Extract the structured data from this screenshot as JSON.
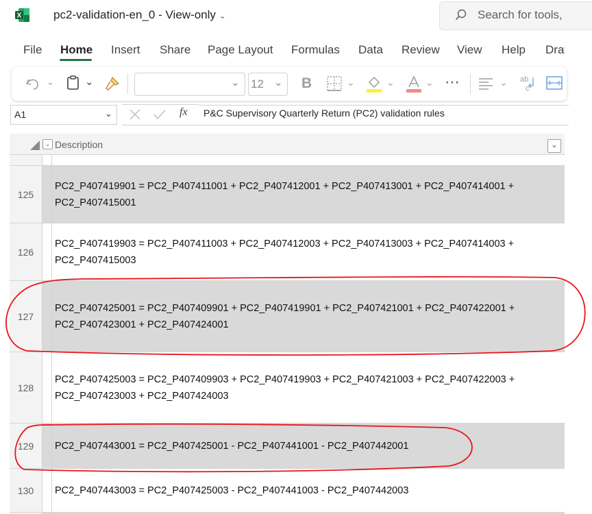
{
  "app": {
    "file_name": "pc2-validation-en_0",
    "mode": "View-only",
    "search_placeholder": "Search for tools,"
  },
  "menu": [
    "File",
    "Home",
    "Insert",
    "Share",
    "Page Layout",
    "Formulas",
    "Data",
    "Review",
    "View",
    "Help",
    "Draw"
  ],
  "toolbar": {
    "font_size": "12",
    "undo_icon": "undo-icon",
    "paste_icon": "clipboard-icon",
    "format_painter_icon": "brush-icon",
    "bold_label": "B"
  },
  "formula_bar": {
    "name_box": "A1",
    "fx": "fx",
    "content": "P&C Supervisory Quarterly Return (PC2) validation rules"
  },
  "grid": {
    "column_header": "Description",
    "rows": [
      {
        "num": "125",
        "shaded": true,
        "lines": [
          "PC2_P407419901 = PC2_P407411001 + PC2_P407412001 + PC2_P407413001 + PC2_P407414001 +",
          "PC2_P407415001"
        ]
      },
      {
        "num": "126",
        "shaded": false,
        "lines": [
          "PC2_P407419903 = PC2_P407411003 + PC2_P407412003 + PC2_P407413003 + PC2_P407414003 +",
          "PC2_P407415003"
        ]
      },
      {
        "num": "127",
        "shaded": true,
        "lines": [
          "PC2_P407425001 = PC2_P407409901 + PC2_P407419901 + PC2_P407421001 + PC2_P407422001 +",
          "PC2_P407423001 + PC2_P407424001"
        ]
      },
      {
        "num": "128",
        "shaded": false,
        "lines": [
          "PC2_P407425003 = PC2_P407409903 + PC2_P407419903 + PC2_P407421003 + PC2_P407422003 +",
          "PC2_P407423003 + PC2_P407424003"
        ]
      },
      {
        "num": "129",
        "shaded": true,
        "lines": [
          "PC2_P407443001 = PC2_P407425001 - PC2_P407441001 - PC2_P407442001"
        ]
      },
      {
        "num": "130",
        "shaded": false,
        "lines": [
          "PC2_P407443003 = PC2_P407425003 - PC2_P407441003 - PC2_P407442003"
        ]
      }
    ]
  },
  "colors": {
    "excel_green": "#217346",
    "annotation_red": "#e8141b",
    "row_shade": "#d9d9d9"
  }
}
